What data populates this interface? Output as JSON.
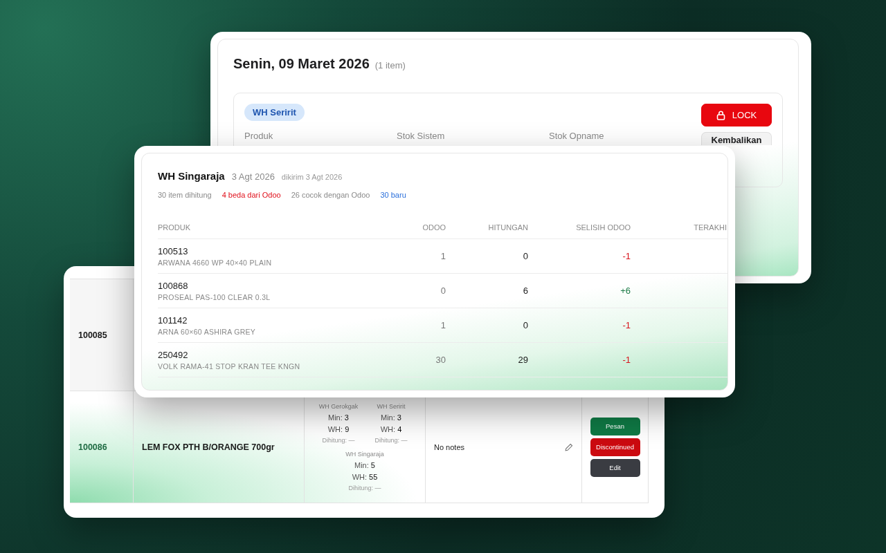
{
  "back_card": {
    "title": "Senin, 09 Maret 2026",
    "count": "(1 item)",
    "warehouse_tag": "WH Seririt",
    "columns": [
      "Produk",
      "Stok Sistem",
      "Stok Opname"
    ],
    "buttons": [
      {
        "label": "LOCK",
        "kind": "danger"
      },
      {
        "label": "Kembalikan",
        "kind": "neutral"
      }
    ]
  },
  "front_card": {
    "warehouse": "WH Singaraja",
    "date": "3 Agt 2026",
    "sent": "dikirim 3 Agt 2026",
    "stats": [
      {
        "text": "30 item dihitung",
        "color": "#8a8a8a"
      },
      {
        "text": "4 beda dari Odoo",
        "color": "#e0101b"
      },
      {
        "text": "26 cocok dengan Odoo",
        "color": "#8a8a8a"
      },
      {
        "text": "30 baru",
        "color": "#2a6fdb"
      }
    ],
    "columns": [
      "PRODUK",
      "ODOO",
      "HITUNGAN",
      "SELISIH ODOO",
      "TERAKHI"
    ],
    "rows": [
      {
        "code": "100513",
        "name": "ARWANA 4660 WP 40×40 PLAIN",
        "odoo": "1",
        "count": "0",
        "diff": "-1",
        "color": "#d8141c"
      },
      {
        "code": "100868",
        "name": "PROSEAL PAS-100 CLEAR 0.3L",
        "odoo": "0",
        "count": "6",
        "diff": "+6",
        "color": "#1a7a45"
      },
      {
        "code": "101142",
        "name": "ARNA 60×60 ASHIRA GREY",
        "odoo": "1",
        "count": "0",
        "diff": "-1",
        "color": "#d8141c"
      },
      {
        "code": "250492",
        "name": "VOLK RAMA-41 STOP KRAN TEE KNGN",
        "odoo": "30",
        "count": "29",
        "diff": "-1",
        "color": "#d8141c"
      }
    ]
  },
  "left_card": {
    "rows": [
      {
        "code": "100085",
        "highlighted": false
      },
      {
        "code": "100086",
        "highlighted": true,
        "product": "LEM FOX PTH B/ORANGE 700gr",
        "stock": [
          {
            "warehouse": "WH Gerokgak",
            "min": "Min: **3**",
            "wh": "WH: **9**",
            "counted": "Dihitung: —"
          },
          {
            "warehouse": "WH Seririt",
            "min": "Min: **3**",
            "wh": "WH: **4**",
            "counted": "Dihitung: —"
          },
          {
            "warehouse": "WH Singaraja",
            "min": "Min: **5**",
            "wh": "WH: **55**",
            "counted": "Dihitung: —"
          }
        ],
        "notes": "No notes",
        "actions": [
          {
            "label": "Pesan",
            "kind": "order"
          },
          {
            "label": "Discontinued",
            "kind": "danger"
          },
          {
            "label": "Edit",
            "kind": "dark"
          }
        ]
      }
    ]
  }
}
